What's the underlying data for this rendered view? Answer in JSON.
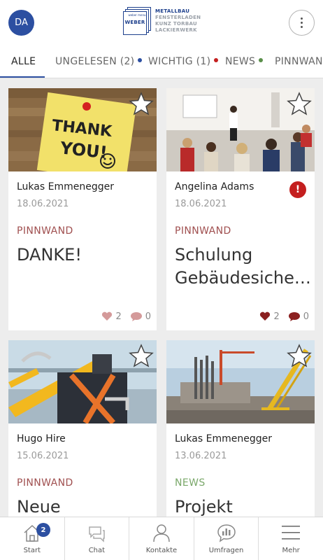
{
  "header": {
    "avatar_initials": "DA",
    "logo": {
      "brand": "WEBER",
      "tagline_small": "weber menu",
      "lines": [
        "METALLBAU",
        "FENSTERLADEN",
        "KUNZ TORBAU",
        "LACKIERWERK"
      ]
    },
    "more_icon": "vertical-dots-icon"
  },
  "tabs": [
    {
      "label": "ALLE",
      "active": true
    },
    {
      "label": "UNGELESEN (2)",
      "dot_color": "#2c4fa1"
    },
    {
      "label": "WICHTIG (1)",
      "dot_color": "#c41f1f"
    },
    {
      "label": "NEWS",
      "dot_color": "#5a8f4a"
    },
    {
      "label": "PINNWAND"
    }
  ],
  "cards": [
    {
      "author": "Lukas Emmenegger",
      "date": "18.06.2021",
      "category": "PINNWAND",
      "category_color": "#a05050",
      "title": "DANKE!",
      "likes": "2",
      "comments": "0",
      "liked": false,
      "image": "thank-you-note",
      "note_text": [
        "THANK",
        "YOU!"
      ]
    },
    {
      "author": "Angelina Adams",
      "date": "18.06.2021",
      "category": "PINNWAND",
      "category_color": "#a05050",
      "title": "Schulung Gebäudesiche…",
      "likes": "2",
      "comments": "0",
      "liked": true,
      "important": "!",
      "image": "training-room"
    },
    {
      "author": "Hugo Hire",
      "date": "15.06.2021",
      "category": "PINNWAND",
      "category_color": "#a05050",
      "title": "Neue",
      "image": "safety-harness"
    },
    {
      "author": "Lukas Emmenegger",
      "date": "13.06.2021",
      "category": "NEWS",
      "category_color": "#7aa86a",
      "title": "Projekt",
      "image": "construction-site"
    }
  ],
  "bottom_nav": [
    {
      "label": "Start",
      "icon": "home-icon",
      "badge": "2"
    },
    {
      "label": "Chat",
      "icon": "chat-icon"
    },
    {
      "label": "Kontakte",
      "icon": "person-icon"
    },
    {
      "label": "Umfragen",
      "icon": "poll-icon"
    },
    {
      "label": "Mehr",
      "icon": "menu-icon"
    }
  ]
}
